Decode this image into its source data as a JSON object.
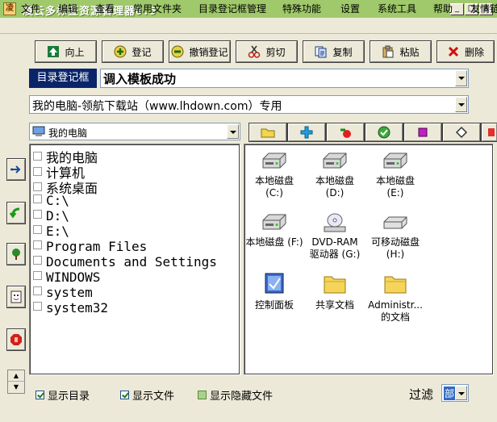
{
  "window": {
    "title": "凌云多标签资源管理器8.5",
    "app_icon_glyph": "凌"
  },
  "menu": [
    "文件",
    "编辑",
    "查看",
    "常用文件夹",
    "目录登记框管理",
    "特殊功能",
    "设置",
    "系统工具",
    "帮助",
    "友情链"
  ],
  "toolbar": {
    "up": "向上",
    "register": "登记",
    "unregister": "撤销登记",
    "cut": "剪切",
    "copy": "复制",
    "paste": "粘贴",
    "delete": "删除"
  },
  "register_box": {
    "label": "目录登记框",
    "value": "调入模板成功"
  },
  "path_combo": {
    "value": "我的电脑-领航下载站（www.lhdown.com）专用"
  },
  "drive_combo": {
    "value": "我的电脑"
  },
  "tree": [
    "我的电脑",
    "计算机",
    "系统桌面",
    "C:\\",
    "D:\\",
    "E:\\",
    "Program Files",
    "Documents and Settings",
    "WINDOWS",
    "system",
    "system32"
  ],
  "files": [
    {
      "line1": "本地磁盘 (C:)",
      "line2": "",
      "icon": "hard-disk-icon"
    },
    {
      "line1": "本地磁盘",
      "line2": "(D:)",
      "icon": "hard-disk-icon"
    },
    {
      "line1": "本地磁盘 (E:)",
      "line2": "",
      "icon": "hard-disk-icon"
    },
    {
      "line1": "本地磁盘 (F:)",
      "line2": "",
      "icon": "hard-disk-icon"
    },
    {
      "line1": "DVD-RAM",
      "line2": "驱动器 (G:)",
      "icon": "dvd-drive-icon"
    },
    {
      "line1": "可移动磁盘",
      "line2": "(H:)",
      "icon": "removable-disk-icon"
    },
    {
      "line1": "控制面板",
      "line2": "",
      "icon": "control-panel-icon"
    },
    {
      "line1": "共享文档",
      "line2": "",
      "icon": "folder-icon"
    },
    {
      "line1": "Administr...",
      "line2": "的文档",
      "icon": "folder-icon"
    }
  ],
  "options": {
    "show_dirs": "显示目录",
    "show_files": "显示文件",
    "show_hidden": "显示隐藏文件",
    "filter_label": "过滤",
    "filter_value": "部"
  },
  "colors": {
    "title_bar": "#9fc96a",
    "register_label_bg": "#0a246a",
    "selection": "#316ac5"
  }
}
